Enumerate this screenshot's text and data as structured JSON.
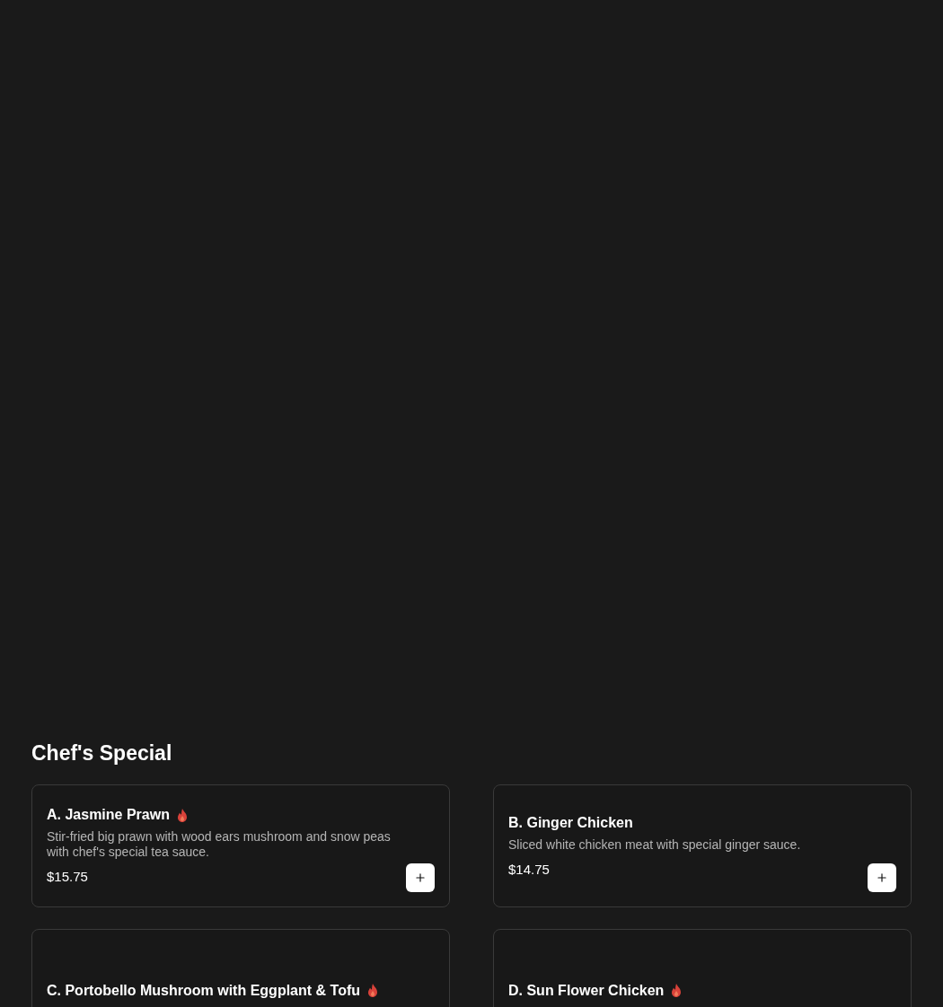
{
  "section": {
    "title": "Chef's Special"
  },
  "items": [
    {
      "name": "A. Jasmine Prawn",
      "spicy": true,
      "description": "Stir-fried big prawn with wood ears mushroom and snow peas with chef's special tea sauce.",
      "price": "$15.75"
    },
    {
      "name": "B. Ginger Chicken",
      "spicy": false,
      "description": "Sliced white chicken meat with special ginger sauce.",
      "price": "$14.75"
    },
    {
      "name": "C. Portobello Mushroom with Eggplant & Tofu",
      "spicy": true
    },
    {
      "name": "D. Sun Flower Chicken",
      "spicy": true
    }
  ]
}
